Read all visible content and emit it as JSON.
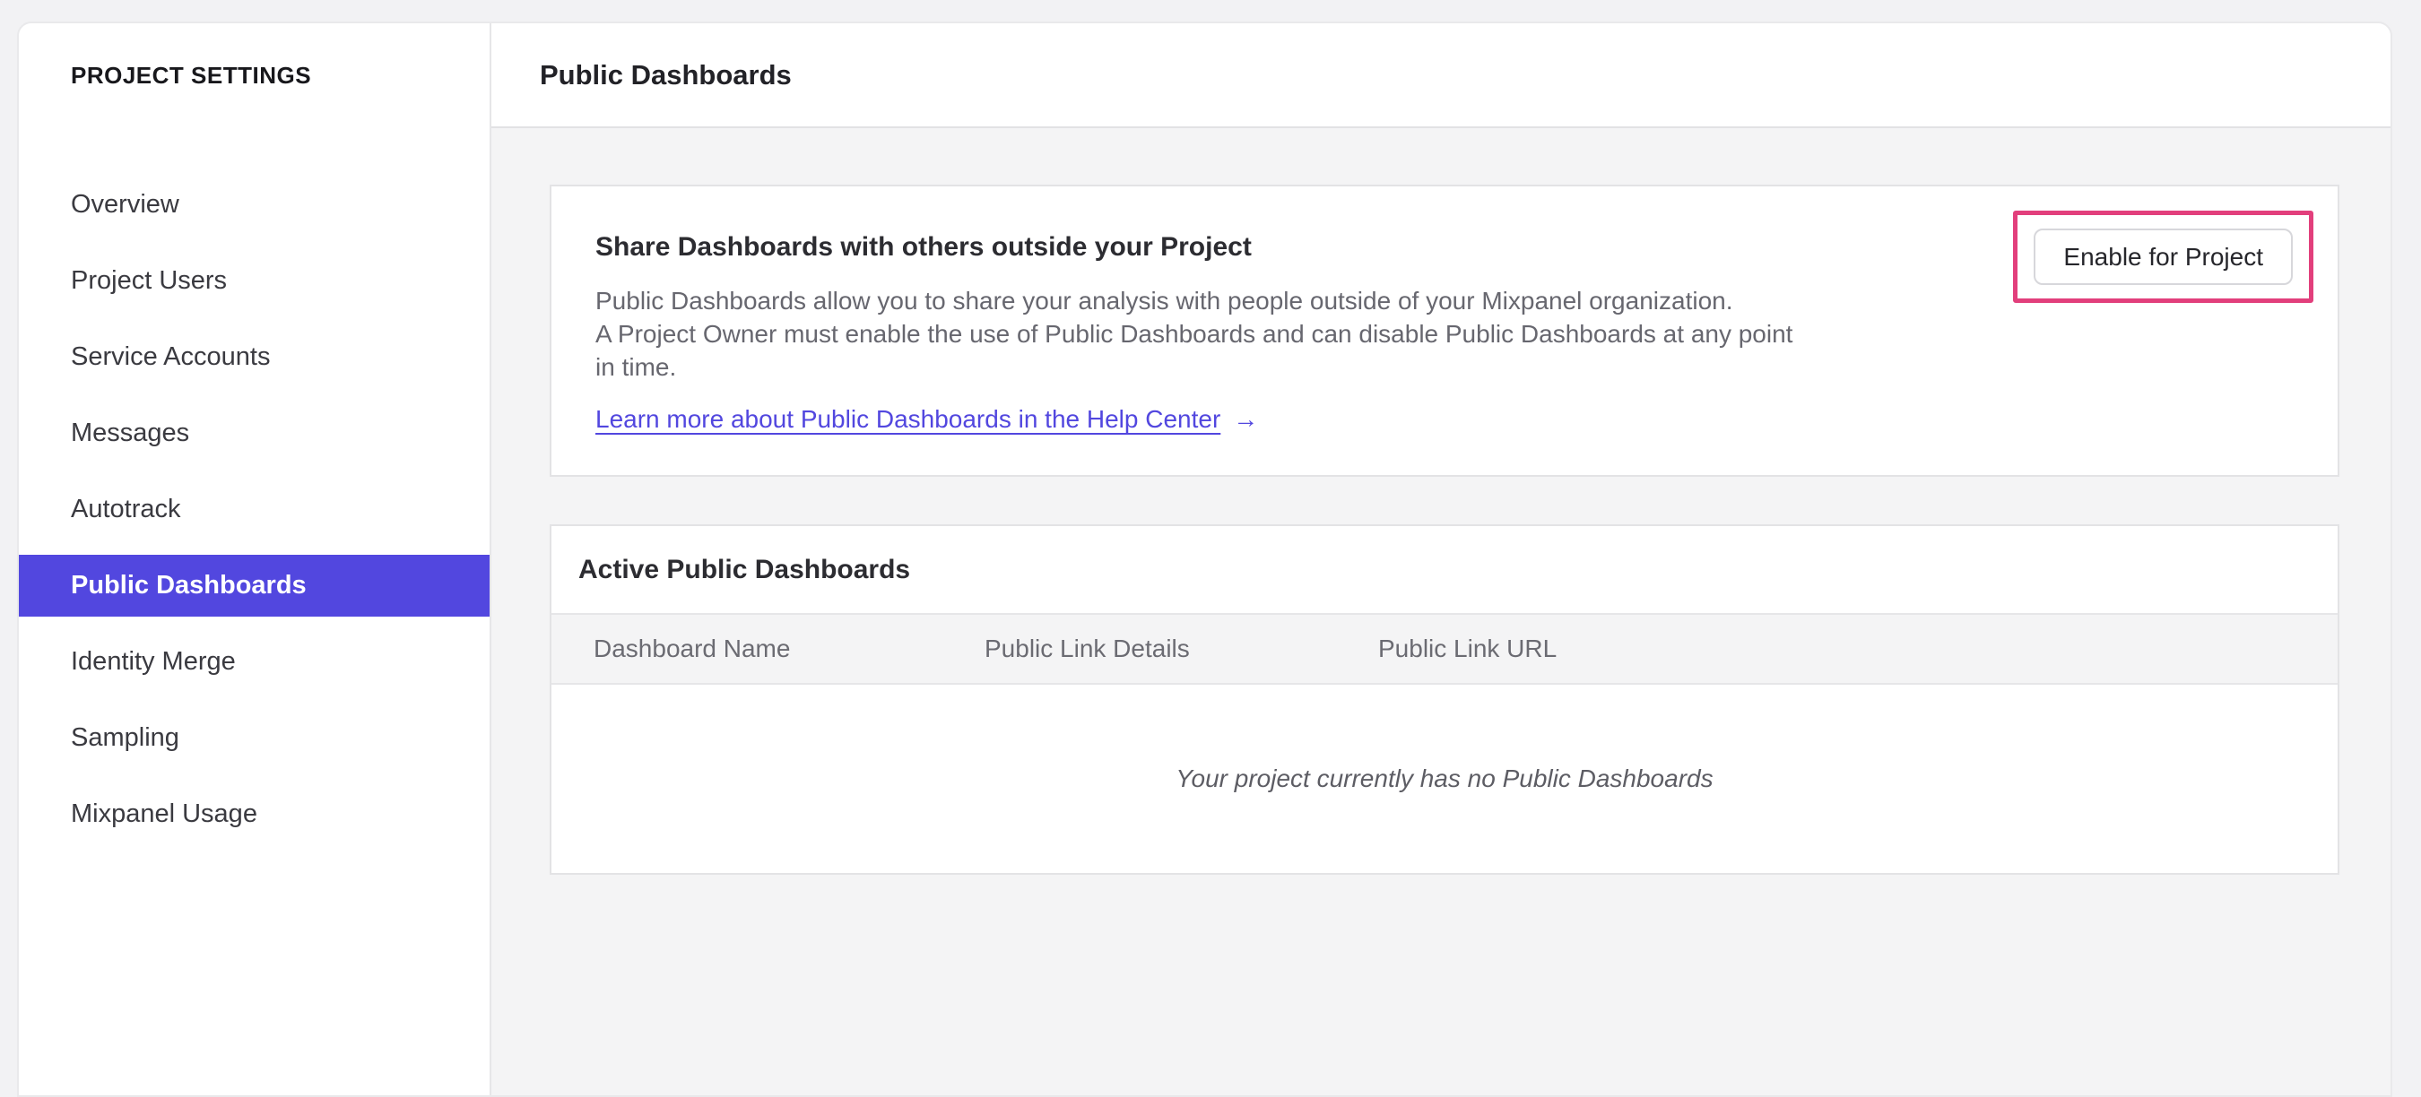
{
  "sidebar": {
    "title": "PROJECT SETTINGS",
    "items": [
      {
        "label": "Overview",
        "selected": false
      },
      {
        "label": "Project Users",
        "selected": false
      },
      {
        "label": "Service Accounts",
        "selected": false
      },
      {
        "label": "Messages",
        "selected": false
      },
      {
        "label": "Autotrack",
        "selected": false
      },
      {
        "label": "Public Dashboards",
        "selected": true
      },
      {
        "label": "Identity Merge",
        "selected": false
      },
      {
        "label": "Sampling",
        "selected": false
      },
      {
        "label": "Mixpanel Usage",
        "selected": false
      }
    ]
  },
  "header": {
    "title": "Public Dashboards"
  },
  "share_card": {
    "heading": "Share Dashboards with others outside your Project",
    "description_lines": [
      "Public Dashboards allow you to share your analysis with people outside of your Mixpanel organization.",
      "A Project Owner must enable the use of Public Dashboards and can disable Public Dashboards at any point",
      "in time."
    ],
    "link_label": "Learn more about Public Dashboards in the Help Center",
    "link_arrow": "→",
    "button_label": "Enable for Project"
  },
  "active_card": {
    "heading": "Active Public Dashboards",
    "columns": [
      "Dashboard Name",
      "Public Link Details",
      "Public Link URL"
    ],
    "empty_message": "Your project currently has no Public Dashboards"
  },
  "colors": {
    "accent_purple": "#5247df",
    "highlight_pink": "#e23f7c",
    "page_background": "#f4f4f5"
  }
}
